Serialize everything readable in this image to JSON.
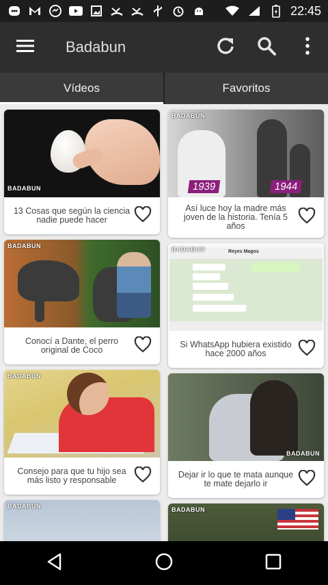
{
  "status_bar": {
    "time": "22:45",
    "left_icons": [
      "messenger-icon",
      "gmail-icon",
      "chat-bubble-icon",
      "youtube-icon",
      "gallery-icon",
      "missed-call-icon",
      "missed-call-icon",
      "usb-icon",
      "alarm-icon",
      "android-icon"
    ],
    "right_icons": [
      "wifi-icon",
      "signal-icon",
      "battery-charging-icon"
    ]
  },
  "app_bar": {
    "title": "Badabun",
    "icons": [
      "menu-icon",
      "refresh-icon",
      "search-icon",
      "more-vert-icon"
    ]
  },
  "tabs": [
    {
      "label": "Vídeos",
      "active": true
    },
    {
      "label": "Favoritos",
      "active": false
    }
  ],
  "feed": {
    "watermark": "BADABUN",
    "left_column": [
      {
        "title": "13 Cosas que según la ciencia nadie puede hacer"
      },
      {
        "title": "Conocí a Dante, el perro original de Coco"
      },
      {
        "title": "Consejo para que tu hijo sea más listo y responsable"
      }
    ],
    "right_column": [
      {
        "title": "Así luce hoy la madre más joven de la historia. Tenía 5 años",
        "badges": [
          "1939",
          "1944"
        ]
      },
      {
        "title": "Si WhatsApp hubiera existido hace 2000 años",
        "chat_header": "Reyes Magos"
      },
      {
        "title": "Dejar ir lo que te mata aunque te mate dejarlo ir"
      }
    ]
  },
  "nav_bar": {
    "icons": [
      "back-icon",
      "home-icon",
      "recents-icon"
    ]
  },
  "colors": {
    "app_bar": "#2e2e2e",
    "tabs": "#3a3a3a",
    "badge_purple": "#8b1f7c"
  }
}
